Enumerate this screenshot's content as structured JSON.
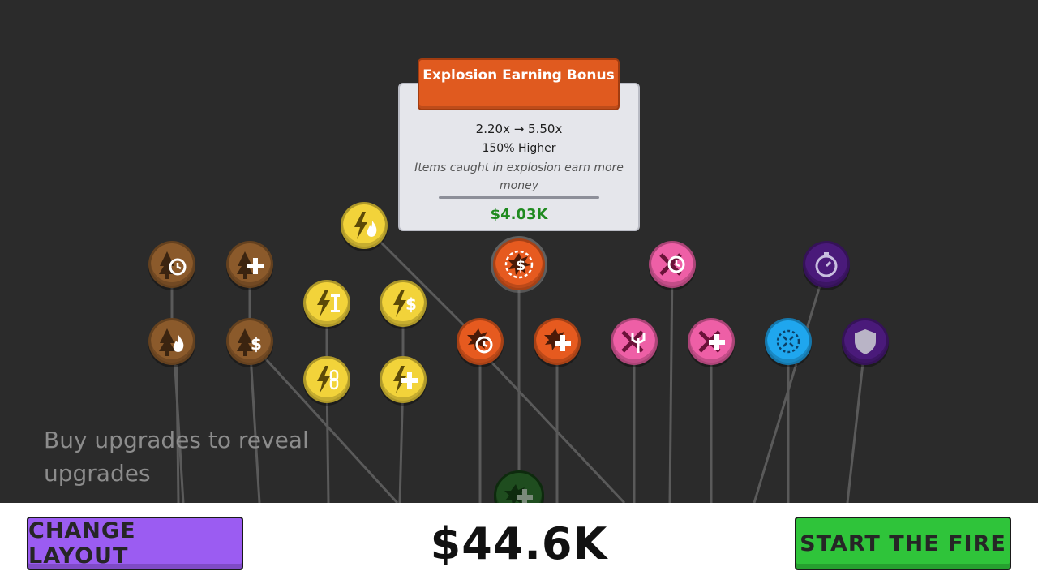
{
  "colors": {
    "background": "#2b2b2b",
    "tree": "#8b5a2b",
    "power": "#f2d33a",
    "explosion": "#e65a1f",
    "pink": "#ee5fa6",
    "blue": "#1fa6ee",
    "purple": "#4a1a7a",
    "locked": "#1f4d1f"
  },
  "hint": {
    "text": "Buy upgrades to reveal upgrades"
  },
  "tooltip": {
    "title": "Explosion Earning Bonus",
    "ratio": "2.20x → 5.50x",
    "change": "150% Higher",
    "description": "Items caught in explosion earn more money",
    "price": "$4.03K"
  },
  "footer": {
    "change_layout_label": "CHANGE LAYOUT",
    "money": "$44.6K",
    "start_fire_label": "START THE FIRE"
  },
  "upgrades": [
    {
      "name": "tree-speed",
      "group": "tree",
      "icon": "tree-clock-icon"
    },
    {
      "name": "tree-count",
      "group": "tree",
      "icon": "tree-plus-icon"
    },
    {
      "name": "tree-fire",
      "group": "tree",
      "icon": "tree-fire-icon"
    },
    {
      "name": "tree-money",
      "group": "tree",
      "icon": "tree-dollar-icon"
    },
    {
      "name": "lightning-fire",
      "group": "power",
      "icon": "lightning-fire-icon"
    },
    {
      "name": "lightning-length",
      "group": "power",
      "icon": "lightning-length-icon"
    },
    {
      "name": "lightning-money",
      "group": "power",
      "icon": "lightning-dollar-icon"
    },
    {
      "name": "lightning-chain",
      "group": "power",
      "icon": "lightning-chain-icon"
    },
    {
      "name": "lightning-count",
      "group": "power",
      "icon": "lightning-plus-icon"
    },
    {
      "name": "explosion-earning",
      "group": "explosion",
      "icon": "explosion-dollar-icon",
      "selected": true
    },
    {
      "name": "explosion-speed",
      "group": "explosion",
      "icon": "explosion-clock-icon"
    },
    {
      "name": "explosion-count",
      "group": "explosion",
      "icon": "explosion-plus-icon"
    },
    {
      "name": "pink-speed",
      "group": "pink",
      "icon": "cross-clock-icon"
    },
    {
      "name": "pink-fork",
      "group": "pink",
      "icon": "cross-trident-icon"
    },
    {
      "name": "pink-count",
      "group": "pink",
      "icon": "cross-plus-icon"
    },
    {
      "name": "blue-area",
      "group": "blue",
      "icon": "area-expand-icon"
    },
    {
      "name": "purple-timer",
      "group": "purple",
      "icon": "stopwatch-icon"
    },
    {
      "name": "purple-shield",
      "group": "purple",
      "icon": "shield-icon"
    },
    {
      "name": "locked-node",
      "group": "locked",
      "icon": "locked-plus-icon"
    }
  ]
}
